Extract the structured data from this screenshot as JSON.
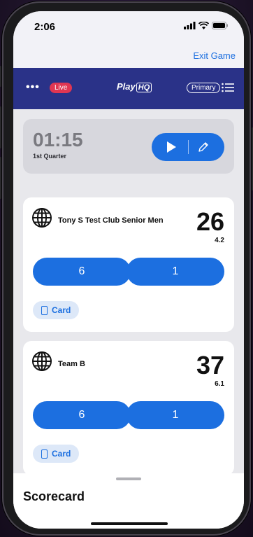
{
  "status_bar": {
    "time": "2:06",
    "icons": [
      "signal-icon",
      "wifi-icon",
      "battery-icon"
    ]
  },
  "header": {
    "exit_label": "Exit Game"
  },
  "nav": {
    "more_icon": "more-dots-icon",
    "live_label": "Live",
    "logo_text": "Play",
    "logo_badge": "HQ",
    "mode_label": "Primary",
    "menu_icon": "list-menu-icon"
  },
  "clock": {
    "time": "01:15",
    "period": "1st Quarter",
    "play_icon": "play-icon",
    "edit_icon": "pencil-icon"
  },
  "teams": [
    {
      "name": "Tony S Test Club Senior Men",
      "score": "26",
      "sub_score": "4.2",
      "goal_label": "6",
      "behind_label": "1",
      "card_label": "Card",
      "logo_icon": "globe-icon"
    },
    {
      "name": "Team B",
      "score": "37",
      "sub_score": "6.1",
      "goal_label": "6",
      "behind_label": "1",
      "card_label": "Card",
      "logo_icon": "globe-icon"
    }
  ],
  "sheet": {
    "title": "Scorecard"
  },
  "colors": {
    "accent": "#1c6fe0",
    "nav": "#2a3288",
    "live": "#e03652"
  }
}
